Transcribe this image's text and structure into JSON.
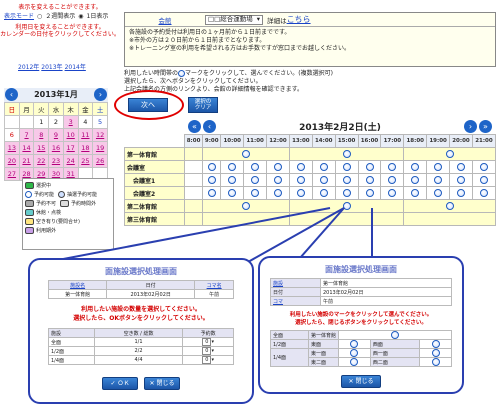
{
  "notes": {
    "display_change": "表示を変えることができます。",
    "display_mode_label": "表示モード",
    "mode_two_month": "２週間表示",
    "mode_one_day": "1日表示",
    "date_change_1": "利用日を変えることができます。",
    "date_change_2": "カレンダーの日付をクリックしてください。"
  },
  "year_links": [
    "2012年",
    "2013年",
    "2014年"
  ],
  "calendar": {
    "title": "2013年1月",
    "weekdays": [
      "日",
      "月",
      "火",
      "水",
      "木",
      "金",
      "土"
    ],
    "rows": [
      [
        "",
        "",
        "1",
        "2",
        "3",
        "4",
        "5"
      ],
      [
        "6",
        "7",
        "8",
        "9",
        "10",
        "11",
        "12"
      ],
      [
        "13",
        "14",
        "15",
        "16",
        "17",
        "18",
        "19"
      ],
      [
        "20",
        "21",
        "22",
        "23",
        "24",
        "25",
        "26"
      ],
      [
        "27",
        "28",
        "29",
        "30",
        "31",
        "",
        ""
      ]
    ]
  },
  "facility": {
    "hall_label": "会館",
    "hall_value": "□□総合運動場",
    "details_prefix": "詳細は",
    "details_link": "こちら",
    "info_lines": [
      "各施設の予約受付は利用日の１ヶ月前から１日前までです。",
      "※市外の方は２０日前から１日前までとなります。",
      "※トレーニング室の利用を希望される方はお手数ですが窓口までお越しください。"
    ]
  },
  "instructions": {
    "line1a": "利用したい時間帯の",
    "line1b": "マークをクリックして、選んでください。(複数選択可)",
    "line2": "選択したら、次へボタンをクリックしてください。",
    "line3": "上記会議名の方側のリンクより、会館の詳細情報を確認できます。"
  },
  "buttons": {
    "next": "次へ",
    "clear_1": "選択の",
    "clear_2": "クリア"
  },
  "schedule": {
    "date_title": "2013年2月2日(土)",
    "hours": [
      "8:00",
      "9:00",
      "10:00",
      "11:00",
      "12:00",
      "13:00",
      "14:00",
      "15:00",
      "16:00",
      "17:00",
      "18:00",
      "19:00",
      "20:00",
      "21:00"
    ],
    "rooms": [
      "第一体育館",
      "会議室",
      "会議室1",
      "会議室2",
      "第二体育館",
      "第三体育館"
    ]
  },
  "legend": [
    "選択中",
    "予約可能",
    "抽選予約可能",
    "予約不可",
    "予約時間外",
    "休館・点検",
    "空き有り(要問合せ)",
    "利用期外"
  ],
  "popup_left": {
    "title": "面施設選択処理画面",
    "headers": [
      "施設名",
      "日付",
      "コマ名"
    ],
    "values": [
      "第一体育館",
      "2013年02月02日",
      "午前"
    ],
    "msg1": "利用したい施設の数量を選択してください。",
    "msg2": "選択したら、OKボタンをクリックしてください。",
    "col_headers": [
      "施設",
      "空き数 / 総数",
      "予約数"
    ],
    "rows": [
      [
        "全面",
        "1/1",
        "0"
      ],
      [
        "1/2面",
        "2/2",
        "0"
      ],
      [
        "1/4面",
        "4/4",
        "0"
      ]
    ],
    "ok": "ＯＫ",
    "close": "閉じる"
  },
  "popup_right": {
    "title": "面施設選択処理画面",
    "headers": [
      "施設",
      "日付",
      "コマ"
    ],
    "values": [
      "第一体育館",
      "2013年02月02日",
      "午前"
    ],
    "msg1": "利用したい施設のマークをクリックして選んでください。",
    "msg2": "選択したら、閉じるボタンをクリックしてください。",
    "rows": [
      [
        "全面",
        "第一体育館"
      ],
      [
        "1/2面",
        "東面",
        "西面"
      ],
      [
        "1/4面",
        "東一面",
        "東二面",
        "西一面",
        "西二面"
      ]
    ],
    "close": "閉じる"
  }
}
